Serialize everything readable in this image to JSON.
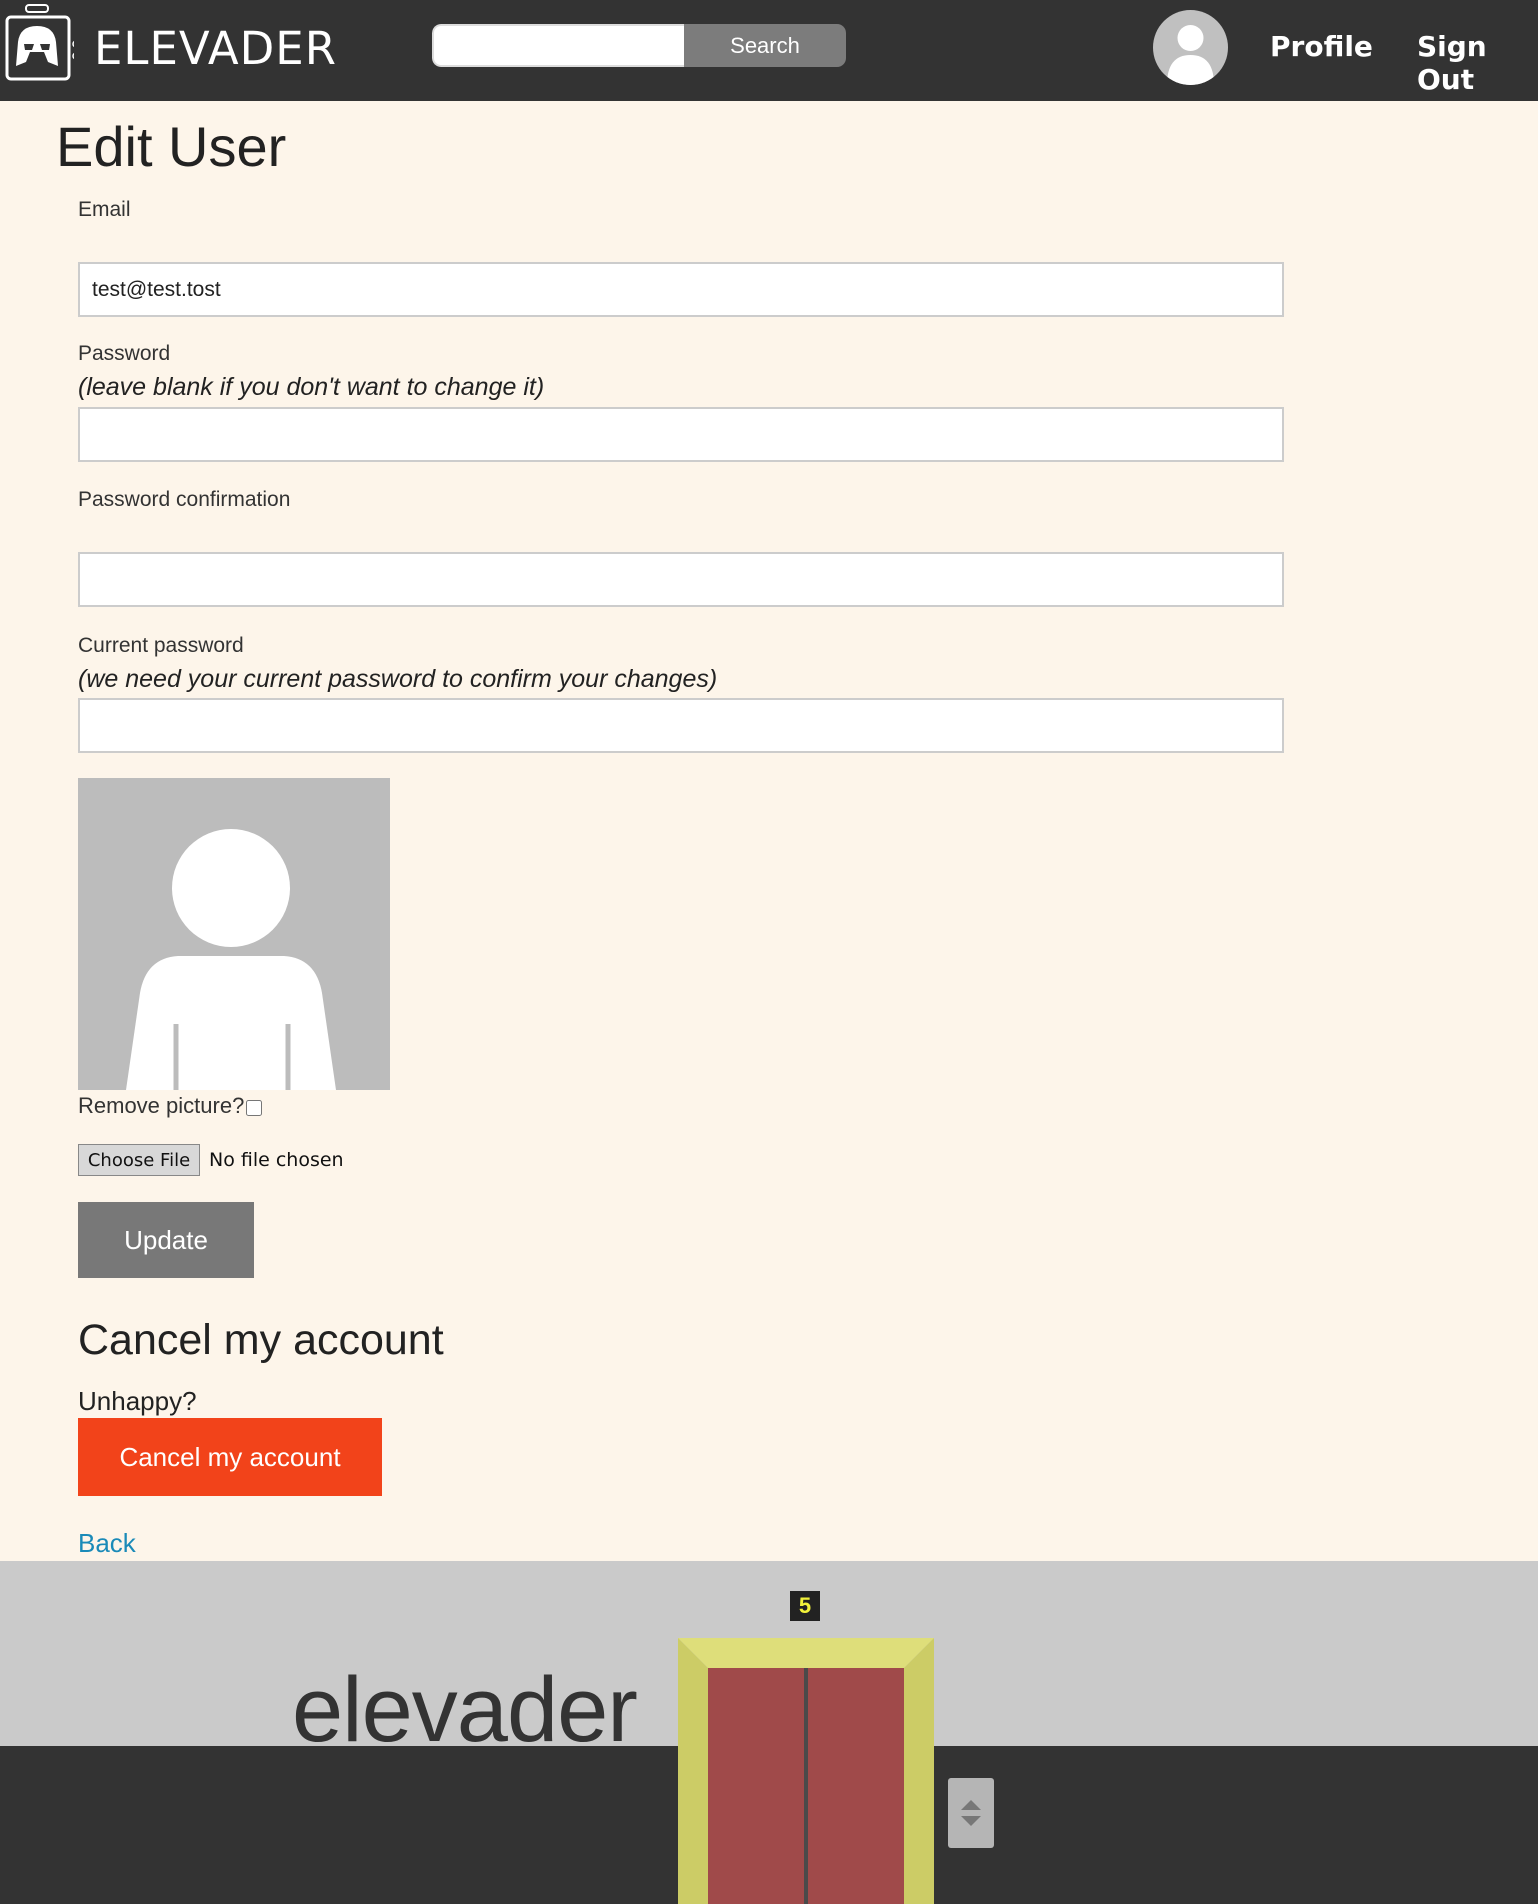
{
  "header": {
    "brand": "ELEVADER",
    "search_placeholder": "",
    "search_button": "Search",
    "nav": {
      "profile": "Profile",
      "sign_out": "Sign Out"
    }
  },
  "form": {
    "title": "Edit User",
    "email_label": "Email",
    "email_value": "test@test.tost",
    "password_label": "Password",
    "password_hint": "(leave blank if you don't want to change it)",
    "password_confirmation_label": "Password confirmation",
    "current_password_label": "Current password",
    "current_password_hint": "(we need your current password to confirm your changes)",
    "remove_picture_label": "Remove picture?",
    "remove_picture_checked": false,
    "file_button": "Choose File",
    "file_status": "No file chosen",
    "update_button": "Update"
  },
  "cancel_section": {
    "heading": "Cancel my account",
    "prompt": "Unhappy?",
    "button": "Cancel my account"
  },
  "back_link": "Back",
  "footer": {
    "wordmark": "elevader",
    "floor_number": "5"
  },
  "colors": {
    "header_bg": "#333333",
    "page_bg": "#fdf5ea",
    "cancel_button": "#f2431a",
    "update_button": "#787878",
    "link": "#1a8ab8",
    "elevator_frame": "#cdcd69",
    "elevator_door": "#a04a4a"
  }
}
